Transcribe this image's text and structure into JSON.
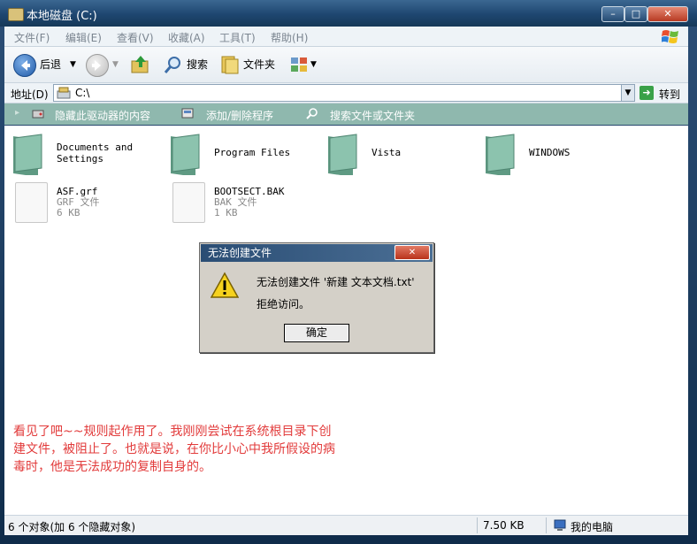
{
  "window": {
    "title": "本地磁盘 (C:)",
    "controls": [
      "–",
      "□",
      "✕"
    ]
  },
  "menu": [
    "文件(F)",
    "编辑(E)",
    "查看(V)",
    "收藏(A)",
    "工具(T)",
    "帮助(H)"
  ],
  "toolbar": {
    "back_label": "后退",
    "search_label": "搜索",
    "folders_label": "文件夹"
  },
  "address": {
    "label": "地址(D)",
    "value": "C:\\",
    "go_label": "转到"
  },
  "tasks": [
    "隐藏此驱动器的内容",
    "添加/删除程序",
    "搜索文件或文件夹"
  ],
  "folders": [
    {
      "name": "Documents and\nSettings"
    },
    {
      "name": "Program Files"
    },
    {
      "name": "Vista"
    },
    {
      "name": "WINDOWS"
    }
  ],
  "files": [
    {
      "name": "ASF.grf",
      "type": "GRF 文件",
      "size": "6 KB"
    },
    {
      "name": "BOOTSECT.BAK",
      "type": "BAK 文件",
      "size": "1 KB"
    }
  ],
  "dialog": {
    "title": "无法创建文件",
    "line1": "无法创建文件 '新建 文本文档.txt'",
    "line2": "拒绝访问。",
    "ok_label": "确定"
  },
  "annotation": "看见了吧~~规则起作用了。我刚刚尝试在系统根目录下创建文件，被阻止了。也就是说，在你比小心中我所假设的病毒时，他是无法成功的复制自身的。",
  "status": {
    "objects": "6 个对象(加 6 个隐藏对象)",
    "size": "7.50 KB",
    "location": "我的电脑"
  },
  "colors": {
    "task_bar": "#8fb8ae",
    "annotation_text": "#e23b3b",
    "folder_green": "#6fa892"
  }
}
